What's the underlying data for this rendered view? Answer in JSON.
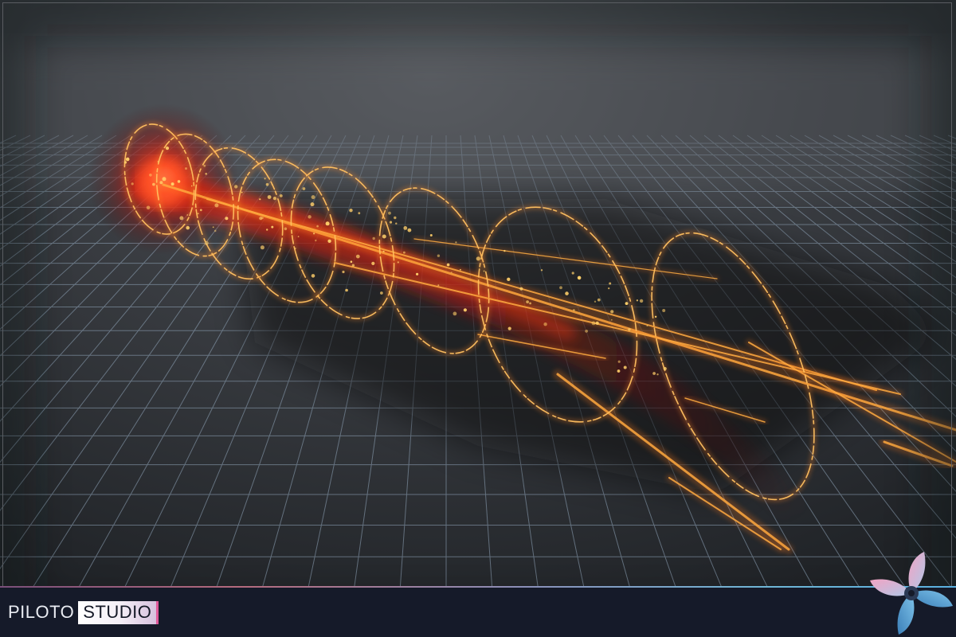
{
  "scene": {
    "description_color_floor": "#2b2e32",
    "grid_line_color": "#8ea3b8",
    "beam_core_color": "#ff2a10",
    "ring_color": "#ffb347",
    "spark_color": "#ffcf6a"
  },
  "branding": {
    "word_left": "PILOTO",
    "word_right": "STUDIO",
    "logo_icon": "propeller-logo-icon",
    "accent_pink": "#e0589a",
    "accent_blue": "#5ab0e0"
  }
}
